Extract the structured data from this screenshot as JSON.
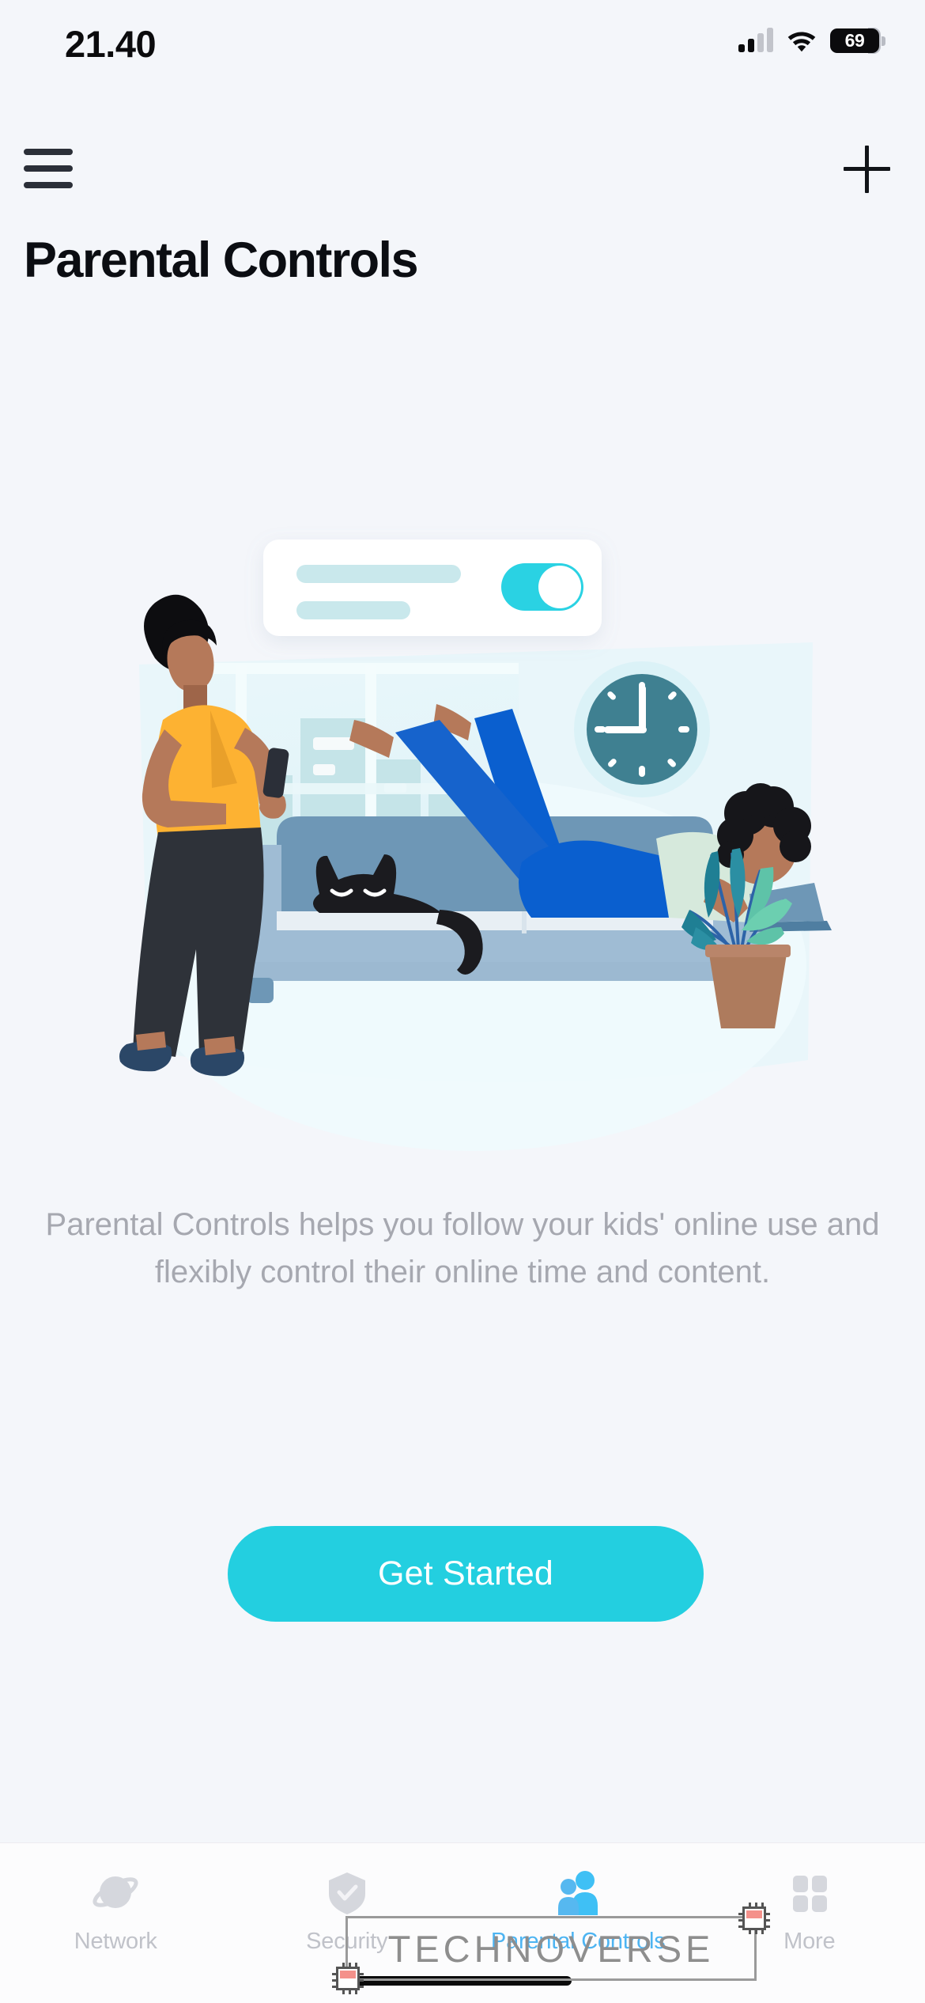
{
  "status_bar": {
    "time": "21.40",
    "battery_percent": "69",
    "signal_icon": "cellular-signal-icon",
    "wifi_icon": "wifi-icon",
    "battery_icon": "battery-icon"
  },
  "nav": {
    "menu_icon": "hamburger-menu-icon",
    "add_icon": "plus-icon"
  },
  "page": {
    "title": "Parental Controls",
    "description": "Parental Controls helps you follow your kids' online use and flexibly control their online time and content."
  },
  "cta": {
    "label": "Get Started"
  },
  "illustration": {
    "name": "parental-controls-illustration",
    "toggle_state": "on",
    "clock_time": "9:00",
    "colors": {
      "accent_cyan": "#23cfe0",
      "card_white": "#ffffff",
      "bar_teal": "#c9e8ec",
      "window_light": "#dff3f7",
      "skyline": "#c5e4e8",
      "couch_dark": "#6e97b6",
      "couch_light": "#9fbcd4",
      "cushion": "#e8eff4",
      "shirt_orange": "#fdb232",
      "pants_dark": "#2e3239",
      "skin_tone": "#b5795a",
      "jeans_blue": "#0a5fcf",
      "tee_mint": "#d6e9dc",
      "cat_black": "#1b1b1f",
      "clock_teal": "#3f8091",
      "plant_teal": "#2b8fa3",
      "plant_mint": "#6ccfb0",
      "pot_brown": "#ae7b5d",
      "shoe_navy": "#2b4767"
    }
  },
  "tabs": [
    {
      "label": "Network",
      "icon": "planet-network-icon",
      "active": false
    },
    {
      "label": "Security",
      "icon": "shield-check-icon",
      "active": false
    },
    {
      "label": "Parental Controls",
      "icon": "people-icon",
      "active": true
    },
    {
      "label": "More",
      "icon": "grid-squares-icon",
      "active": false
    }
  ],
  "watermark": {
    "text": "TECHNOVERSE",
    "chip_icon": "microchip-icon"
  },
  "colors": {
    "background": "#f4f6fa",
    "accent": "#23cfe0",
    "active_tab": "#4db4f2",
    "muted_text": "#a6a8b0"
  }
}
